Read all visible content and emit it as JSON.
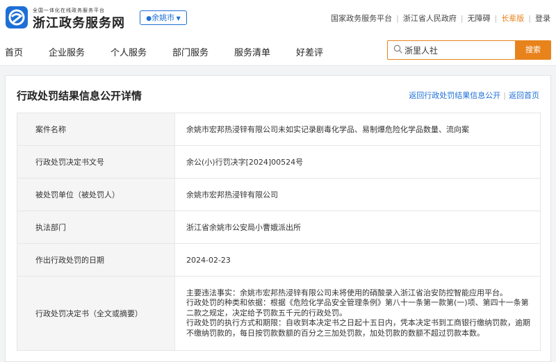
{
  "header": {
    "logo_subtitle": "全国一体化在线政务服务平台",
    "logo_title": "浙江政务服务网",
    "city": "余姚市",
    "links": [
      "国家政务服务平台",
      "浙江省人民政府",
      "无障碍",
      "长辈版",
      "登录"
    ],
    "colors": {
      "primary": "#1d6fd6",
      "accent": "#e8831c"
    }
  },
  "nav": {
    "items": [
      "首页",
      "企业服务",
      "个人服务",
      "部门服务",
      "服务清单",
      "好差评"
    ],
    "search_value": "浙里人社",
    "search_button": "搜索"
  },
  "page": {
    "title": "行政处罚结果信息公开详情",
    "link_back_list": "返回行政处罚结果信息公开",
    "link_home": "返回首页"
  },
  "details": [
    {
      "label": "案件名称",
      "value": "余姚市宏邦热浸锌有限公司未如实记录剧毒化学品、易制爆危险化学品数量、流向案"
    },
    {
      "label": "行政处罚决定书文号",
      "value": "余公(小)行罚决字[2024]00524号"
    },
    {
      "label": "被处罚单位（被处罚人）",
      "value": "余姚市宏邦热浸锌有限公司"
    },
    {
      "label": "执法部门",
      "value": "浙江省余姚市公安局小曹娥派出所"
    },
    {
      "label": "作出行政处罚的日期",
      "value": "2024-02-23"
    },
    {
      "label": "行政处罚决定书（全文或摘要）",
      "paragraphs": [
        "主要违法事实：余姚市宏邦热浸锌有限公司未将使用的硝酸录入浙江省治安防控智能应用平台。",
        "行政处罚的种类和依据：根据《危险化学品安全管理条例》第八十一条第一款第(一)项、第四十一条第二款之规定，决定给予罚款五千元的行政处罚。",
        "行政处罚的执行方式和期限：自收到本决定书之日起十五日内，凭本决定书到工商银行缴纳罚款，逾期不缴纳罚款的，每日按罚款数额的百分之三加处罚款，加处罚款的数额不超过罚款本数。"
      ]
    }
  ]
}
